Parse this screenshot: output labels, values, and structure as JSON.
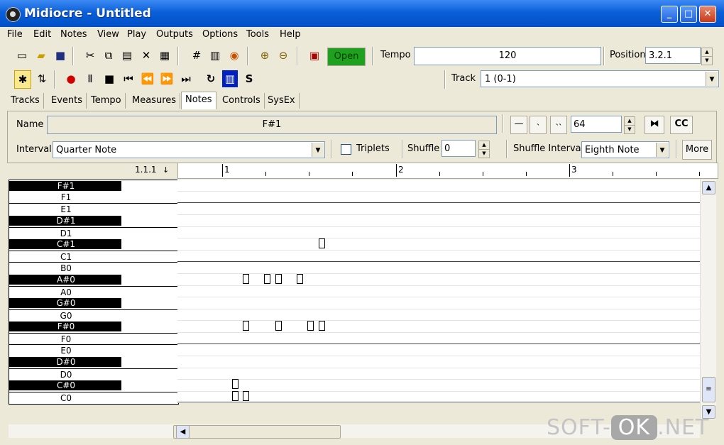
{
  "window": {
    "title": "Midiocre - Untitled",
    "minimize": "_",
    "maximize": "□",
    "close": "✕"
  },
  "menu": [
    "File",
    "Edit",
    "Notes",
    "View",
    "Play",
    "Outputs",
    "Options",
    "Tools",
    "Help"
  ],
  "toolbar": {
    "open_label": "Open",
    "tempo_label": "Tempo",
    "tempo_value": "120",
    "position_label": "Position",
    "position_value": "3.2.1",
    "track_label": "Track",
    "track_value": "1 (0-1)"
  },
  "tabs": [
    "Tracks",
    "Events",
    "Tempo",
    "Measures",
    "Notes",
    "Controls",
    "SysEx"
  ],
  "active_tab": "Notes",
  "note_panel": {
    "name_label": "Name",
    "name_value": "F#1",
    "velocity_value": "64",
    "cc_label": "CC",
    "interval_label": "Interval",
    "interval_value": "Quarter Note",
    "triplets_label": "Triplets",
    "shuffle_label": "Shuffle",
    "shuffle_value": "0",
    "shuffle_interval_label": "Shuffle Interval",
    "shuffle_interval_value": "Eighth Note",
    "more_label": "More"
  },
  "ruler": {
    "start": "1.1.1",
    "measures": [
      "1",
      "2",
      "3"
    ]
  },
  "keys": [
    "F#1",
    "F1",
    "E1",
    "D#1",
    "D1",
    "C#1",
    "C1",
    "B0",
    "A#0",
    "A0",
    "G#0",
    "G0",
    "F#0",
    "F0",
    "E0",
    "D#0",
    "D0",
    "C#0",
    "C0"
  ],
  "watermark": {
    "left": "SOFT-",
    "box": "OK",
    "right": ".NET"
  }
}
